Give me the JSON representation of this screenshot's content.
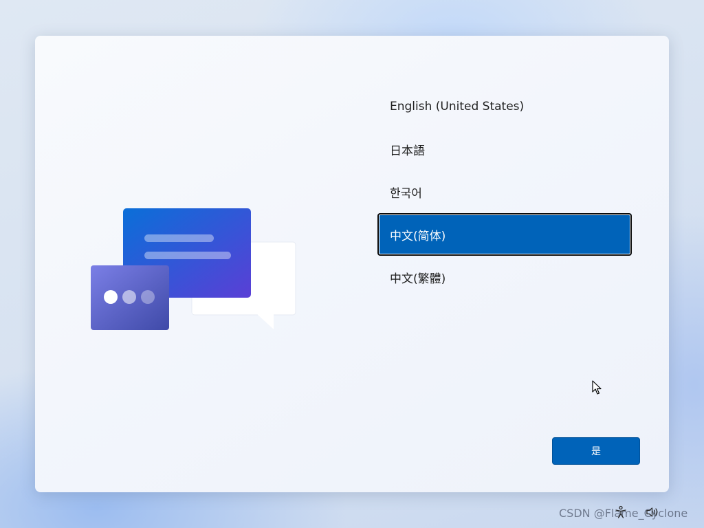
{
  "languages": [
    {
      "label": "English (United States)",
      "selected": false
    },
    {
      "label": "日本語",
      "selected": false
    },
    {
      "label": "한국어",
      "selected": false
    },
    {
      "label": "中文(简体)",
      "selected": true
    },
    {
      "label": "中文(繁體)",
      "selected": false
    }
  ],
  "yes_button": {
    "label": "是"
  },
  "taskbar": {
    "icons": [
      "accessibility-icon",
      "volume-icon"
    ]
  },
  "watermark": {
    "text": "CSDN @Flame_Cyclone"
  },
  "colors": {
    "accent": "#0063b9",
    "illustration_blue_start": "#0a6fd8",
    "illustration_purple_end": "#5a3fd6",
    "illustration_card": "#5e62c9"
  }
}
